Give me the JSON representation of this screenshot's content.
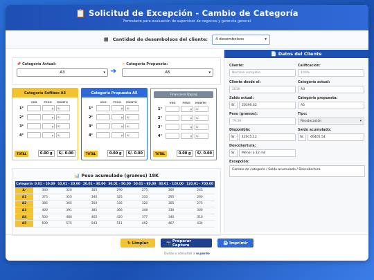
{
  "header": {
    "title": "Solicitud de Excepción - Cambio de Categoría",
    "subtitle": "Formulario para evaluación de supervisor de negocios y gerencia general",
    "icon": "clipboard-icon"
  },
  "quantity": {
    "label": "Cantidad de desembolsos del cliente:",
    "value": "4 desembolsos",
    "icon": "table-icon"
  },
  "categories": {
    "current_label": "Categoría Actual:",
    "current_value": "A3",
    "proposed_label": "Categoría Propuesta:",
    "proposed_value": "A5",
    "arrow": "➜"
  },
  "tables": [
    {
      "title": "Categoría Softbox A3",
      "cols": [
        "VKG",
        "PESO",
        "MONTO"
      ],
      "rows": [
        "1°",
        "2°",
        "3°",
        "4°"
      ],
      "total_label": "TOTAL",
      "total_peso": "0.00",
      "unit": "g",
      "total_monto": "S/. 0.00"
    },
    {
      "title": "Categoría Propuesta A5",
      "cols": [
        "VKG",
        "PESO",
        "MONTO"
      ],
      "rows": [
        "1°",
        "2°",
        "3°",
        "4°"
      ],
      "total_label": "TOTAL",
      "total_peso": "0.00",
      "unit": "g",
      "total_monto": "S/. 0.00"
    },
    {
      "title": "Financiera Qapaq",
      "cols": [
        "VKG",
        "PESO",
        "MONTO"
      ],
      "rows": [
        "1°",
        "2°",
        "3°",
        "4°"
      ],
      "total_label": "TOTAL",
      "total_peso": "0.00",
      "unit": "g",
      "total_monto": "S/. 0.00"
    }
  ],
  "row_g": "g",
  "row_s": "S/.",
  "peso": {
    "title": "Peso acumulado (gramos) 18K",
    "icon": "chart-icon",
    "headers": [
      "Categoría",
      "0.01 - 10.00",
      "10.01 - 20.00",
      "20.01 - 30.00",
      "30.01 - 50.00",
      "50.01 - 80.00",
      "80.01 - 120.00",
      "120.01 - 700.00"
    ],
    "rows": [
      [
        "A-",
        "340",
        "320",
        "305",
        "290",
        "275",
        "260",
        "245"
      ],
      [
        "A1",
        "375",
        "355",
        "340",
        "325",
        "310",
        "295",
        "260"
      ],
      [
        "A2",
        "385",
        "365",
        "350",
        "335",
        "320",
        "305",
        "275"
      ],
      [
        "A3",
        "400",
        "391",
        "385",
        "366",
        "348",
        "330",
        "300"
      ],
      [
        "A4",
        "500",
        "480",
        "465",
        "420",
        "377",
        "340",
        "310"
      ],
      [
        "A5",
        "600",
        "575",
        "543",
        "511",
        "492",
        "467",
        "434"
      ]
    ]
  },
  "client": {
    "title": "Datos del Cliente",
    "icon": "document-icon",
    "cliente_l": "Cliente:",
    "cliente_v": "Nombre completo",
    "calif_l": "Calificación:",
    "calif_v": "100%",
    "desde_l": "Cliente desde el:",
    "desde_v": "2016",
    "catact_l": "Categoría actual:",
    "catact_v": "A3",
    "saldo_l": "Saldo actual:",
    "saldo_cur": "S/.",
    "saldo_v": "20390.42",
    "catprop_l": "Categoría propuesta:",
    "catprop_v": "A5",
    "peso_l": "Peso (gramos):",
    "peso_v": "79.39",
    "tipo_l": "Tipo:",
    "tipo_v": "Recolocación",
    "disp_l": "Disponible:",
    "disp_cur": "S/.",
    "disp_v": "12615.12",
    "acum_l": "Saldo acumulado:",
    "acum_cur": "S/.",
    "acum_v": "46405.54",
    "desc_l": "Descobertura:",
    "desc_cur": "S/.",
    "desc_v": "Menor a 12 mil",
    "exc_l": "Excepción:",
    "exc_v": "Cambio de categoría / Saldo acumulado / Descobertura"
  },
  "buttons": {
    "clear": "Limpiar",
    "capture": "Preparar Captura",
    "print": "Imprimir"
  },
  "footer": {
    "text": "Dudas o consultas a",
    "contact": "w.pardo"
  },
  "colors": {
    "primary": "#1e4fb3",
    "accent": "#f2c230",
    "dark": "#1e3f8f"
  }
}
